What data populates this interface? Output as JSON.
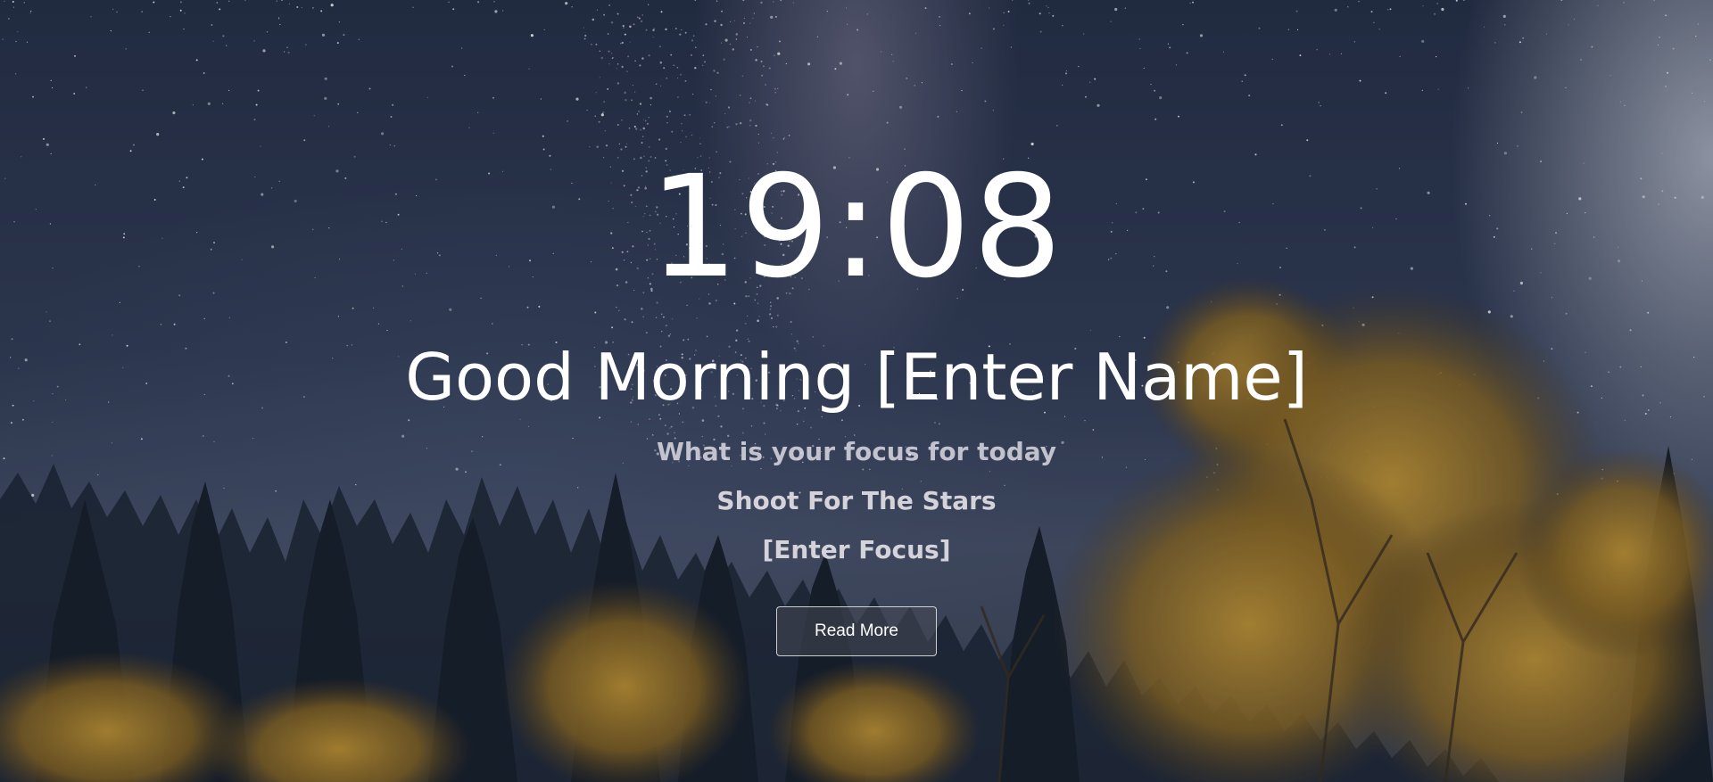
{
  "clock": {
    "time": "19:08"
  },
  "greeting": {
    "text": "Good Morning [Enter Name]"
  },
  "focus": {
    "question": "What is your focus for today",
    "quote": "Shoot For The Stars",
    "entry": "[Enter Focus]"
  },
  "actions": {
    "read_more_label": "Read More"
  },
  "background": {
    "scene": "starry-night-forest",
    "sky_color": "#2a3246",
    "foliage_color": "#b98a2c"
  }
}
